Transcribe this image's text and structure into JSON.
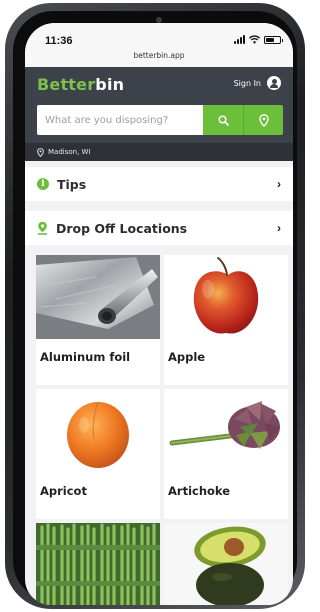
{
  "status": {
    "time": "11:36",
    "url": "betterbin.app"
  },
  "header": {
    "brand_part1": "Better",
    "brand_part2": "bin",
    "signin_label": "Sign In",
    "search_placeholder": "What are you disposing?"
  },
  "location": {
    "text": "Madison, WI"
  },
  "menu": {
    "tips_label": "Tips",
    "dropoff_label": "Drop Off Locations"
  },
  "items": [
    {
      "name": "Aluminum foil",
      "image": "aluminum-foil-roll"
    },
    {
      "name": "Apple",
      "image": "red-apple"
    },
    {
      "name": "Apricot",
      "image": "apricot"
    },
    {
      "name": "Artichoke",
      "image": "artichoke"
    },
    {
      "name": "",
      "image": "asparagus-bundles"
    },
    {
      "name": "",
      "image": "avocado-halves"
    }
  ],
  "colors": {
    "accent": "#6bbf3b",
    "header": "#3d4149",
    "location_bar": "#2e3137"
  }
}
